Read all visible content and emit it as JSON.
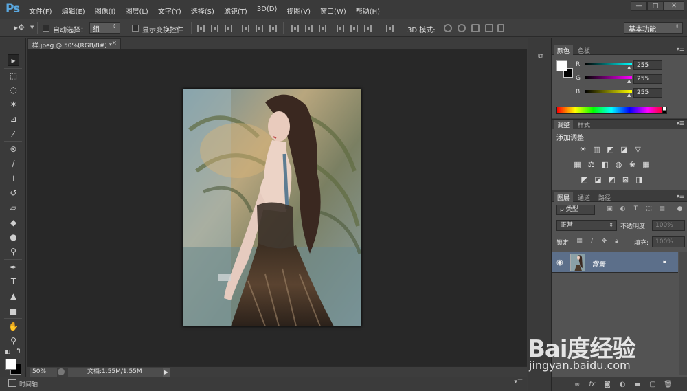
{
  "app": {
    "logo": "Ps"
  },
  "menu": [
    "文件(F)",
    "编辑(E)",
    "图像(I)",
    "图层(L)",
    "文字(Y)",
    "选择(S)",
    "滤镜(T)",
    "3D(D)",
    "视图(V)",
    "窗口(W)",
    "帮助(H)"
  ],
  "window_controls": {
    "minimize": "—",
    "maximize": "□",
    "close": "✕"
  },
  "options": {
    "auto_select_label": "自动选择：",
    "auto_select_value": "组",
    "show_transform_label": "显示变换控件",
    "mode_3d_label": "3D 模式:",
    "workspace": "基本功能"
  },
  "document": {
    "tab_title": "样.jpeg @ 50%(RGB/8#) *",
    "zoom": "50%",
    "doc_info": "文档:1.55M/1.55M"
  },
  "timeline": {
    "label": "时间轴"
  },
  "panels": {
    "color": {
      "tabs": [
        "颜色",
        "色板"
      ],
      "channels": [
        {
          "label": "R",
          "value": "255",
          "color": "#00ffff"
        },
        {
          "label": "G",
          "value": "255",
          "color": "#ff00ff"
        },
        {
          "label": "B",
          "value": "255",
          "color": "#ffff00"
        }
      ]
    },
    "adjustments": {
      "tabs": [
        "调整",
        "样式"
      ],
      "title": "添加调整"
    },
    "layers": {
      "tabs": [
        "图层",
        "通道",
        "路径"
      ],
      "kind": "ρ 类型",
      "blend_mode": "正常",
      "opacity_label": "不透明度:",
      "opacity_value": "100%",
      "lock_label": "锁定:",
      "fill_label": "填充:",
      "fill_value": "100%",
      "layer_name": "背景"
    }
  },
  "watermark": {
    "logo": "Bai度经验",
    "url": "jingyan.baidu.com"
  }
}
